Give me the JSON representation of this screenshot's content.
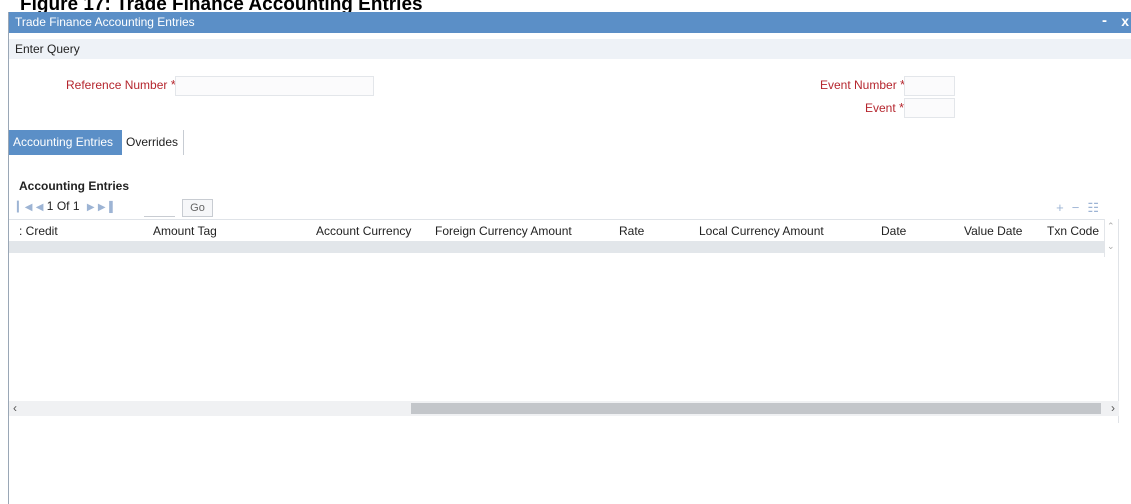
{
  "caption": "Figure 17: Trade Finance Accounting Entries",
  "window": {
    "title": "Trade Finance Accounting Entries",
    "minimize": "-",
    "close": "x"
  },
  "menu": {
    "enter_query": "Enter Query"
  },
  "fields": {
    "reference_number": {
      "label": "Reference Number",
      "required": "*",
      "value": ""
    },
    "event_number": {
      "label": "Event Number",
      "required": "*",
      "value": ""
    },
    "event": {
      "label": "Event",
      "required": "*",
      "value": ""
    }
  },
  "tabs": [
    {
      "label": "Accounting Entries",
      "active": true
    },
    {
      "label": "Overrides",
      "active": false
    }
  ],
  "section": {
    "title": "Accounting Entries"
  },
  "pager": {
    "first_icon": "first-page-icon",
    "prev_icon": "prev-page-icon",
    "current": "1",
    "of_label": "Of",
    "total": "1",
    "next_icon": "next-page-icon",
    "last_icon": "last-page-icon",
    "go_label": "Go"
  },
  "grid_tools": {
    "add": "+",
    "remove": "−",
    "view": "☷"
  },
  "grid": {
    "columns": [
      "Debit/Credit",
      "Amount Tag",
      "Account Currency",
      "Foreign Currency Amount",
      "Rate",
      "Local Currency Amount",
      "Date",
      "Value Date",
      "Txn Code"
    ],
    "visible_first_column": ": Credit",
    "rows": []
  },
  "colors": {
    "titlebar": "#5b8fc7",
    "required_label": "#b5262e",
    "active_tab": "#5b8fc7"
  }
}
